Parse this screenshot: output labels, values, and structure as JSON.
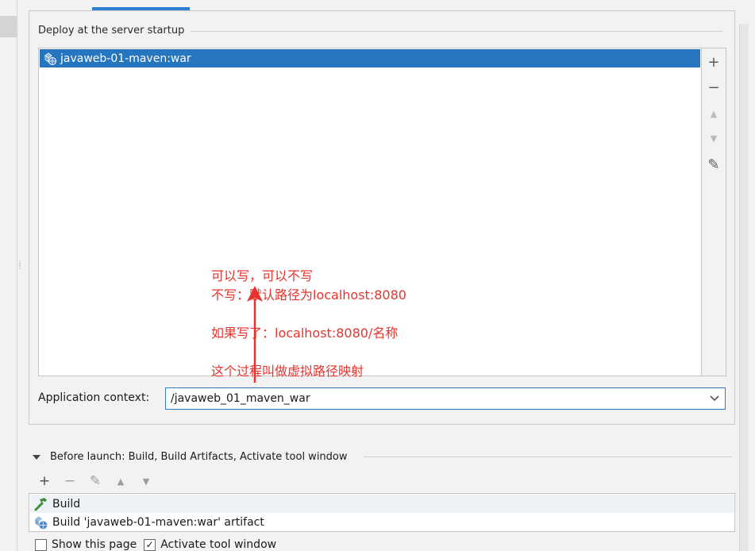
{
  "deploy_section": {
    "title": "Deploy at the server startup",
    "items": [
      {
        "label": "javaweb-01-maven:war",
        "icon": "artifact-icon",
        "selected": true
      }
    ],
    "toolbar": [
      {
        "name": "add-button",
        "glyph": "+",
        "enabled": true
      },
      {
        "name": "remove-button",
        "glyph": "−",
        "enabled": true
      },
      {
        "name": "move-up-button",
        "glyph": "▲",
        "enabled": false
      },
      {
        "name": "move-down-button",
        "glyph": "▼",
        "enabled": false
      },
      {
        "name": "edit-button",
        "glyph": "✎",
        "enabled": true
      }
    ]
  },
  "annotation": {
    "lines": [
      "可以写，可以不写",
      "不写：默认路径为localhost:8080",
      "如果写了：localhost:8080/名称",
      "这个过程叫做虚拟路径映射"
    ],
    "color": "#e8322e"
  },
  "app_context": {
    "label": "Application context:",
    "value": "/javaweb_01_maven_war"
  },
  "before_launch": {
    "title": "Before launch: Build, Build Artifacts, Activate tool window",
    "toolbar": [
      {
        "name": "add-task-button",
        "glyph": "+",
        "enabled": true
      },
      {
        "name": "remove-task-button",
        "glyph": "−",
        "enabled": false
      },
      {
        "name": "edit-task-button",
        "glyph": "✎",
        "enabled": false
      },
      {
        "name": "move-task-up-button",
        "glyph": "▲",
        "enabled": false
      },
      {
        "name": "move-task-down-button",
        "glyph": "▼",
        "enabled": false
      }
    ],
    "tasks": [
      {
        "label": "Build",
        "icon": "hammer-icon"
      },
      {
        "label": "Build 'javaweb-01-maven:war' artifact",
        "icon": "artifact-icon"
      }
    ]
  },
  "options": {
    "show_page": {
      "label": "Show this page",
      "checked": false
    },
    "activate_tool_window": {
      "label": "Activate tool window",
      "checked": true
    }
  },
  "colors": {
    "selection": "#2675bf",
    "focus_border": "#2f7cc7",
    "tab_indicator": "#2e7fd4"
  }
}
